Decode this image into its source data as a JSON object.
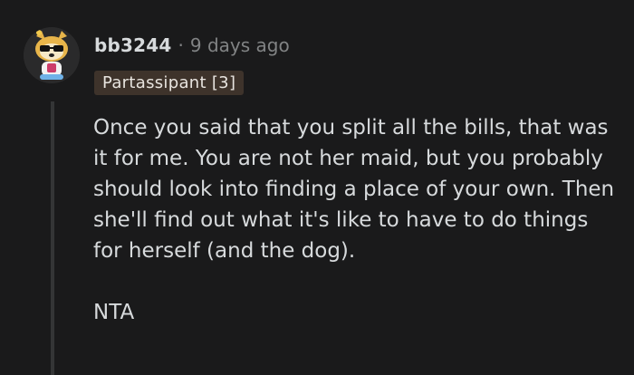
{
  "comment": {
    "username": "bb3244",
    "separator": "·",
    "timestamp": "9 days ago",
    "flair": "Partassipant [3]",
    "paragraphs": [
      "Once you said that you split all the bills, that was it for me. You are not her maid, but you probably should look into finding a place of your own. Then she'll find out what it's like to have to do things for herself (and the dog).",
      "NTA"
    ],
    "avatar_icon": "snoo-avatar-icon"
  },
  "colors": {
    "background": "#1a1a1b",
    "text": "#d7dadc",
    "muted": "#818384",
    "flair_bg": "#3e332b",
    "thread_line": "#343536"
  }
}
